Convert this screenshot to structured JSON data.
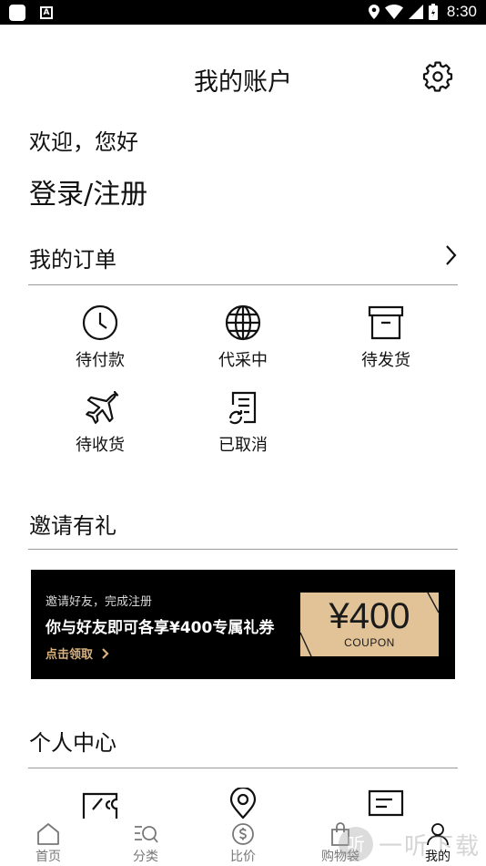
{
  "status_bar": {
    "time": "8:30",
    "app_icon_2": "A"
  },
  "header": {
    "title": "我的账户"
  },
  "account": {
    "welcome": "欢迎，您好",
    "login_register": "登录/注册"
  },
  "orders": {
    "title": "我的订单",
    "items": [
      {
        "label": "待付款",
        "icon": "clock-icon"
      },
      {
        "label": "代采中",
        "icon": "globe-icon"
      },
      {
        "label": "待发货",
        "icon": "archive-box-icon"
      },
      {
        "label": "待收货",
        "icon": "airplane-icon"
      },
      {
        "label": "已取消",
        "icon": "cancelled-doc-icon"
      }
    ]
  },
  "invite": {
    "title": "邀请有礼",
    "subtitle": "邀请好友，完成注册",
    "headline": "你与好友即可各享¥400专属礼券",
    "cta": "点击领取",
    "coupon_amount": "¥400",
    "coupon_label": "COUPON"
  },
  "personal_center": {
    "title": "个人中心",
    "items": [
      {
        "icon": "coupon-icon"
      },
      {
        "icon": "location-pin-icon"
      },
      {
        "icon": "message-icon"
      }
    ]
  },
  "bottom_nav": [
    {
      "label": "首页",
      "icon": "home-icon"
    },
    {
      "label": "分类",
      "icon": "category-search-icon"
    },
    {
      "label": "比价",
      "icon": "price-compare-icon"
    },
    {
      "label": "购物袋",
      "icon": "shopping-bag-icon"
    },
    {
      "label": "我的",
      "icon": "profile-icon",
      "active": true
    }
  ],
  "watermark": {
    "logo_char": "听",
    "text": "一听下载"
  },
  "colors": {
    "status_bar_bg": "#000000",
    "banner_bg": "#000000",
    "coupon_gold": "#e2c398",
    "cta_gold": "#d9b27e",
    "divider": "#9a9a9a",
    "nav_inactive": "#777777"
  }
}
